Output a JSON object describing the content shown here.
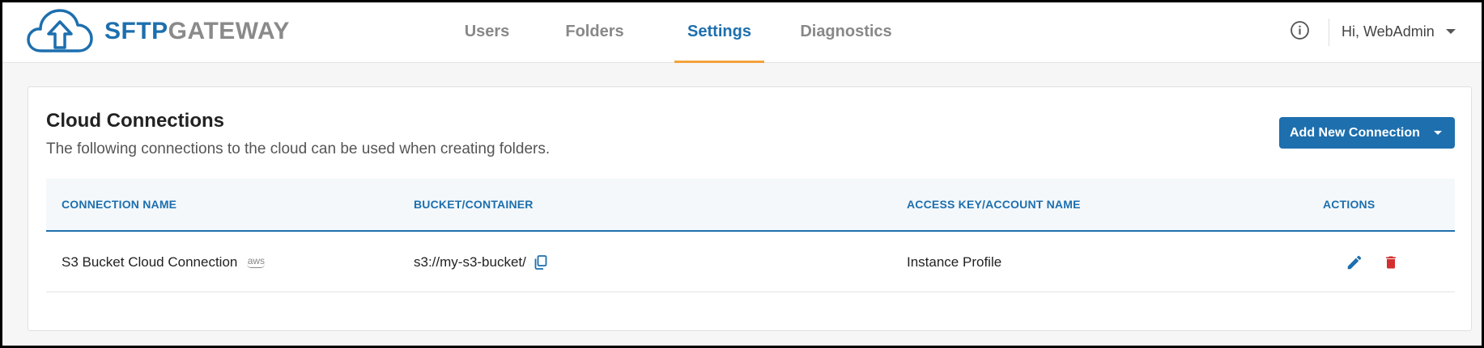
{
  "header": {
    "logo_part1": "SFTP",
    "logo_part2": "GATEWAY",
    "nav": [
      {
        "label": "Users",
        "active": false
      },
      {
        "label": "Folders",
        "active": false
      },
      {
        "label": "Settings",
        "active": true
      },
      {
        "label": "Diagnostics",
        "active": false
      }
    ],
    "user_greeting": "Hi, WebAdmin",
    "icons": [
      "info-icon",
      "chevron-down-icon"
    ]
  },
  "card": {
    "title": "Cloud Connections",
    "subtitle": "The following connections to the cloud can be used when creating folders.",
    "add_button_label": "Add New Connection",
    "table": {
      "columns": [
        "CONNECTION NAME",
        "BUCKET/CONTAINER",
        "ACCESS KEY/ACCOUNT NAME",
        "ACTIONS"
      ],
      "rows": [
        {
          "connection_name": "S3 Bucket Cloud Connection",
          "provider_badge": "aws",
          "bucket": "s3://my-s3-bucket/",
          "access_key": "Instance Profile",
          "actions": [
            "edit-icon",
            "delete-icon"
          ]
        }
      ]
    }
  },
  "colors": {
    "brand_blue": "#1d6fae",
    "brand_gray": "#8a8a8a",
    "active_tab_underline": "#f2a23a",
    "delete_red": "#d32f2f"
  }
}
